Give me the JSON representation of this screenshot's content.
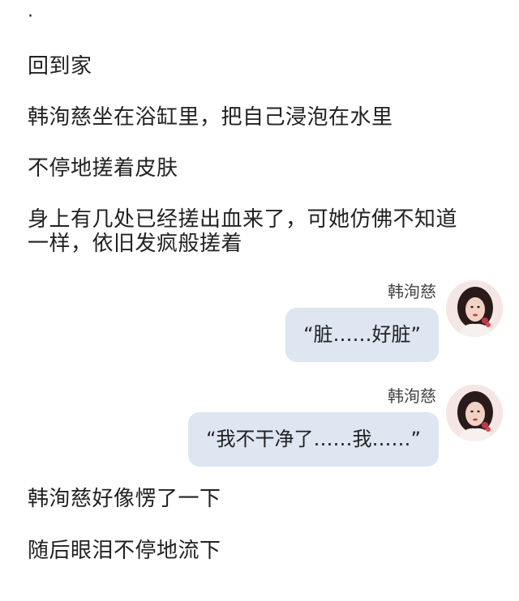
{
  "story": {
    "dot": "·",
    "p1": "回到家",
    "p2": "韩洵慈坐在浴缸里，把自己浸泡在水里",
    "p3": "不停地搓着皮肤",
    "p4_line1": "身上有几处已经搓出血来了，可她仿佛不知道",
    "p4_line2": "一样，依旧发疯般搓着",
    "p5": "韩洵慈好像愣了一下",
    "p6": "随后眼泪不停地流下"
  },
  "messages": [
    {
      "sender": "韩洵慈",
      "text": "“脏……好脏”",
      "avatar_icon": "girl-portrait-avatar"
    },
    {
      "sender": "韩洵慈",
      "text": "“我不干净了……我……”",
      "avatar_icon": "girl-portrait-avatar"
    }
  ],
  "colors": {
    "bubble_bg": "#dde6f1",
    "text": "#222222",
    "sender_text": "#444444",
    "background": "#ffffff"
  }
}
